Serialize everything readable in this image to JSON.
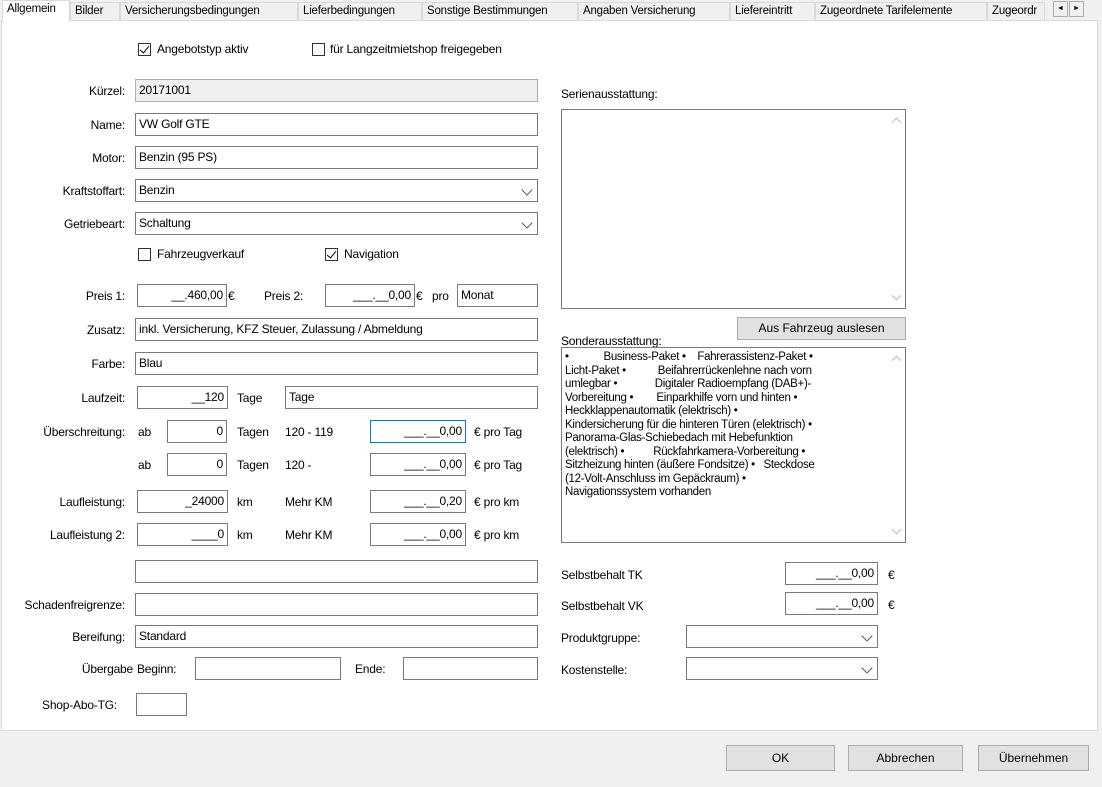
{
  "tabs": [
    "Allgemein",
    "Bilder",
    "Versicherungsbedingungen",
    "Lieferbedingungen",
    "Sonstige Bestimmungen",
    "Angaben Versicherung",
    "Liefereintritt",
    "Zugeordnete Tarifelemente",
    "Zugeordr"
  ],
  "tab_scroll": {
    "left": "◄",
    "right": "►"
  },
  "checkboxes": {
    "angebotstyp_aktiv": {
      "label": "Angebotstyp aktiv",
      "checked": true
    },
    "langzeitmietshop": {
      "label": "für Langzeitmietshop freigegeben",
      "checked": false
    },
    "fahrzeugverkauf": {
      "label": "Fahrzeugverkauf",
      "checked": false
    },
    "navigation": {
      "label": "Navigation",
      "checked": true
    }
  },
  "fields": {
    "kuerzel": {
      "label": "Kürzel:",
      "value": "20171001"
    },
    "name": {
      "label": "Name:",
      "value": "VW Golf GTE"
    },
    "motor": {
      "label": "Motor:",
      "value": "Benzin (95 PS)"
    },
    "kraftstoffart": {
      "label": "Kraftstoffart:",
      "value": "Benzin"
    },
    "getriebeart": {
      "label": "Getriebeart:",
      "value": "Schaltung"
    },
    "preis1": {
      "label": "Preis 1:",
      "value": "__.460,00",
      "unit": "€"
    },
    "preis2": {
      "label": "Preis 2:",
      "value": "___.__0,00",
      "unit": "€",
      "pro_label": "pro",
      "period": "Monat"
    },
    "zusatz": {
      "label": "Zusatz:",
      "value": "inkl. Versicherung, KFZ Steuer, Zulassung / Abmeldung"
    },
    "farbe": {
      "label": "Farbe:",
      "value": "Blau"
    },
    "laufzeit": {
      "label": "Laufzeit:",
      "value": "__120",
      "unit": "Tage",
      "unit_field": "Tage"
    },
    "ueberschreitung": {
      "label": "Überschreitung:",
      "rows": [
        {
          "ab": "ab",
          "value": "0",
          "tagen": "Tagen",
          "range": "120 - 119",
          "price": "___.__0,00",
          "unit": "€ pro Tag"
        },
        {
          "ab": "ab",
          "value": "0",
          "tagen": "Tagen",
          "range": "120 -",
          "price": "___.__0,00",
          "unit": "€ pro Tag"
        }
      ]
    },
    "laufleistung": {
      "label": "Laufleistung:",
      "value": "_24000",
      "unit": "km",
      "mehr": "Mehr KM",
      "price": "___.__0,20",
      "price_unit": "€ pro km"
    },
    "laufleistung2": {
      "label": "Laufleistung 2:",
      "value": "____0",
      "unit": "km",
      "mehr": "Mehr KM",
      "price": "___.__0,00",
      "price_unit": "€ pro km"
    },
    "empty_field": {
      "value": ""
    },
    "schadenfreigrenze": {
      "label": "Schadenfreigrenze:",
      "value": ""
    },
    "bereifung": {
      "label": "Bereifung:",
      "value": "Standard"
    },
    "uebergabe": {
      "label": "Übergabe",
      "beginn_label": "Beginn:",
      "beginn": "",
      "ende_label": "Ende:",
      "ende": ""
    },
    "shop_abo_tg": {
      "label": "Shop-Abo-TG:",
      "value": ""
    }
  },
  "right": {
    "serienausstattung_label": "Serienausstattung:",
    "serienausstattung": "",
    "sonderausstattung_label": "Sonderausstattung:",
    "aus_fahrzeug_button": "Aus Fahrzeug auslesen",
    "sonderausstattung": "•            Business-Paket •    Fahrerassistenz-Paket •\nLicht-Paket •           Beifahrerrückenlehne nach vorn\numlegbar •             Digitaler Radioempfang (DAB+)-\nVorbereitung •        Einparkhilfe vorn und hinten •\nHeckklappenautomatik (elektrisch) •\nKindersicherung für die hinteren Türen (elektrisch) •\nPanorama-Glas-Schiebedach mit Hebefunktion\n(elektrisch) •          Rückfahrkamera-Vorbereitung •\nSitzheizung hinten (äußere Fondsitze) •   Steckdose\n(12-Volt-Anschluss im Gepäckraum) •\nNavigationssystem vorhanden",
    "selbstbehalt_tk": {
      "label": "Selbstbehalt TK",
      "value": "___.__0,00",
      "unit": "€"
    },
    "selbstbehalt_vk": {
      "label": "Selbstbehalt VK",
      "value": "___.__0,00",
      "unit": "€"
    },
    "produktgruppe": {
      "label": "Produktgruppe:",
      "value": ""
    },
    "kostenstelle": {
      "label": "Kostenstelle:",
      "value": ""
    }
  },
  "buttons": {
    "ok": "OK",
    "abbrechen": "Abbrechen",
    "uebernehmen": "Übernehmen"
  },
  "colors": {
    "focus_border": "#0078d7",
    "panel_bg": "#ffffff",
    "window_bg": "#f0f0f0"
  }
}
